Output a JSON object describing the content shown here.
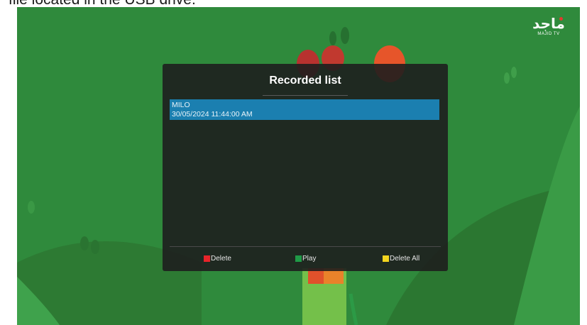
{
  "caption": "file located in the USB drive.",
  "logo": {
    "arabic": "ماجد",
    "subtitle": "MAJID TV"
  },
  "dialog": {
    "title": "Recorded list",
    "recordings": [
      {
        "name": "MILO",
        "datetime": "30/05/2024 11:44:00 AM"
      }
    ]
  },
  "footer_keys": [
    {
      "label": "Delete",
      "color": "#e8242a"
    },
    {
      "label": "Play",
      "color": "#1f9a47"
    },
    {
      "label": "Delete All",
      "color": "#f2d41f"
    }
  ]
}
